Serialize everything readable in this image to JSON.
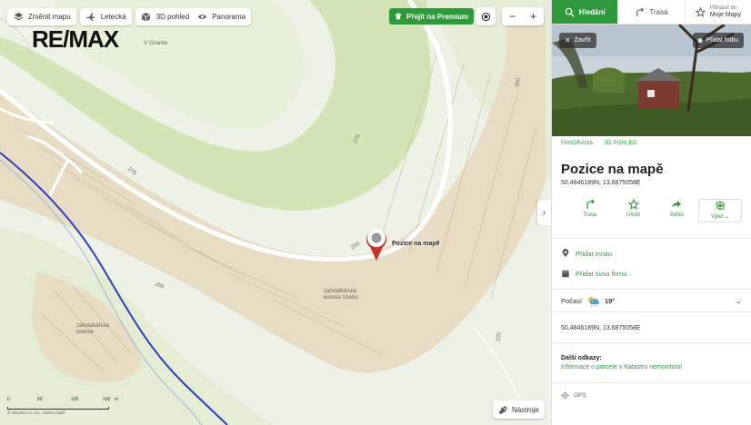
{
  "map": {
    "toolbar": {
      "change_map": "Změnit mapu",
      "aerial": "Letecká",
      "view_3d": "3D pohled",
      "panorama": "Panorama"
    },
    "premium_label": "Přejít na Premium",
    "zoom_out": "−",
    "zoom_in": "+",
    "logo_text": "RE/MAX",
    "labels": {
      "v_granta": "V Granta",
      "contour_275a": "275",
      "contour_275b": "275",
      "contour_250a": "250",
      "contour_250b": "250",
      "contour_250c": "250",
      "contour_225": "225",
      "kolonie_vsebo": "zahrádkářská kolonie Všebo",
      "kolonie": "zahrádkářská kolonie"
    },
    "pin_label": "Pozice na mapě",
    "scale": {
      "ticks": [
        "0",
        "50",
        "100",
        "150"
      ],
      "unit": "m"
    },
    "copyright": "© Seznam.cz, a.s., 2026 a další",
    "tools_label": "Nástroje",
    "collapse_icon": "chevron-right"
  },
  "panel": {
    "tabs": {
      "search": "Hledání",
      "route": "Trasa",
      "mymaps_small": "Přihlásit do",
      "mymaps": "Moje Mapy"
    },
    "photo": {
      "close_label": "Zavřít",
      "add_photo_label": "Přidat fotku"
    },
    "view_tabs": [
      "PANORAMA",
      "3D POHLED"
    ],
    "title": "Pozice na mapě",
    "coords": "50.4846189N, 13.6875058E",
    "actions": {
      "route": "Trasa",
      "save": "Uložit",
      "share": "Sdílet",
      "trip": "Výlet"
    },
    "add_place": "Přidat místo",
    "add_company": "Přidat svou firmu",
    "weather": {
      "label": "Počasí",
      "temp": "19°"
    },
    "coords_repeat": "50.4846189N, 13.6875058E",
    "more_links_title": "Další odkazy:",
    "cadastre_link": "Informace o parcele v Katastru nemovitostí",
    "gps_label": "GPS"
  },
  "colors": {
    "accent": "#2f9a3c",
    "pin": "#c8322c",
    "map_bg": "#eef1e6",
    "settlement": "#e8dcc4",
    "forest": "#cfe3b0",
    "river": "#2b3fbf"
  }
}
